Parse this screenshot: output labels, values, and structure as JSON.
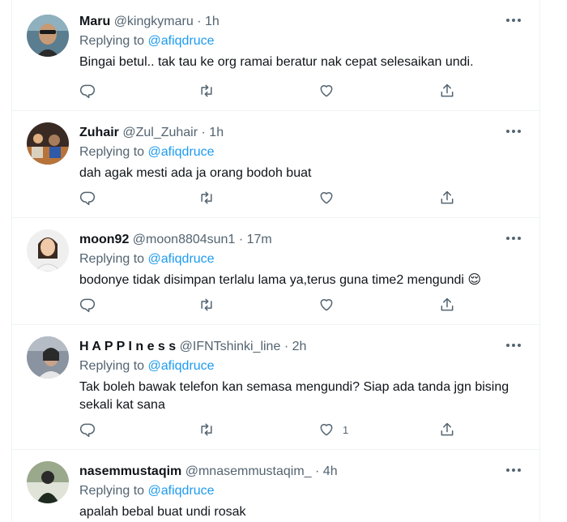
{
  "tweets": [
    {
      "name": "Maru",
      "handle": "@kingkymaru",
      "dot": "·",
      "time": "1h",
      "replying_prefix": "Replying to",
      "replying_to": "@afiqdruce",
      "text": "Bingai betul.. tak tau ke org ramai beratur nak cepat selesaikan undi.",
      "like_count": ""
    },
    {
      "name": "Zuhair",
      "handle": "@Zul_Zuhair",
      "dot": "·",
      "time": "1h",
      "replying_prefix": "Replying to",
      "replying_to": "@afiqdruce",
      "text": "dah agak mesti ada ja orang bodoh buat",
      "like_count": ""
    },
    {
      "name": "moon92",
      "handle": "@moon8804sun1",
      "dot": "·",
      "time": "17m",
      "replying_prefix": "Replying to",
      "replying_to": "@afiqdruce",
      "text": "bodonye tidak disimpan terlalu lama ya,terus guna time2 mengundi 😌",
      "like_count": ""
    },
    {
      "name": "H A P P I n e s s",
      "handle": "@IFNTshinki_line",
      "dot": "·",
      "time": "2h",
      "replying_prefix": "Replying to",
      "replying_to": "@afiqdruce",
      "text": "Tak boleh bawak telefon kan semasa mengundi? Siap ada tanda jgn bising sekali kat sana",
      "like_count": "1"
    },
    {
      "name": "nasemmustaqim",
      "handle": "@mnasemmustaqim_",
      "dot": "·",
      "time": "4h",
      "replying_prefix": "Replying to",
      "replying_to": "@afiqdruce",
      "text": "apalah bebal buat undi rosak",
      "like_count": ""
    }
  ],
  "icons": {
    "reply": "reply-icon",
    "retweet": "retweet-icon",
    "like": "like-icon",
    "share": "share-icon",
    "more": "more-icon"
  },
  "colors": {
    "link": "#1d9bf0",
    "secondary_text": "#536471",
    "primary_text": "#0f1419",
    "divider": "#eff3f4"
  }
}
